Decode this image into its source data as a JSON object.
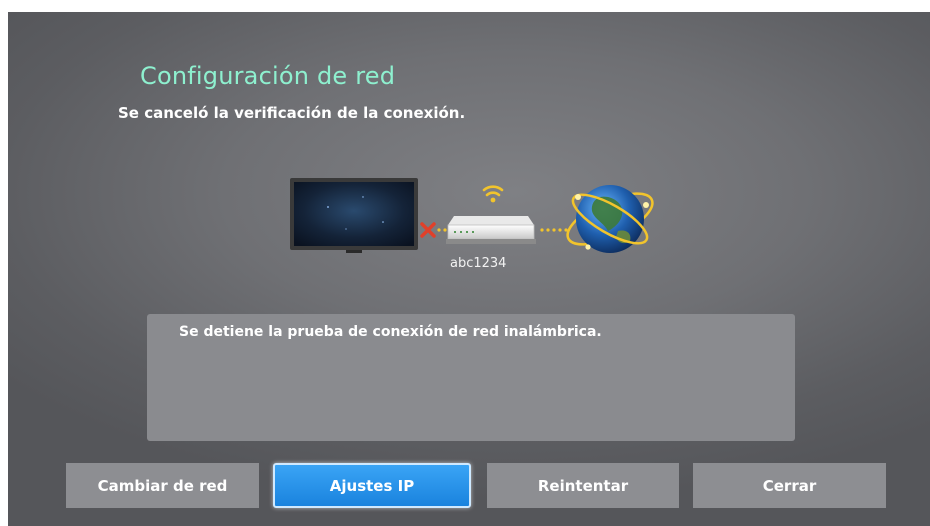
{
  "dialog": {
    "title": "Configuración de red",
    "subtitle": "Se canceló la verificación de la conexión.",
    "router_name": "abc1234",
    "message": "Se detiene la prueba de conexión de red inalámbrica."
  },
  "buttons": [
    {
      "label": "Cambiar de red",
      "selected": false
    },
    {
      "label": "Ajustes IP",
      "selected": true
    },
    {
      "label": "Reintentar",
      "selected": false
    },
    {
      "label": "Cerrar",
      "selected": false
    }
  ],
  "colors": {
    "title": "#8ef0cf",
    "selected_button": "#1a83de",
    "error_mark": "#e0402a",
    "link_dots": "#f2c42c"
  },
  "icons": [
    "tv-icon",
    "disconnected-x-icon",
    "router-icon",
    "wifi-signal-icon",
    "globe-icon"
  ]
}
